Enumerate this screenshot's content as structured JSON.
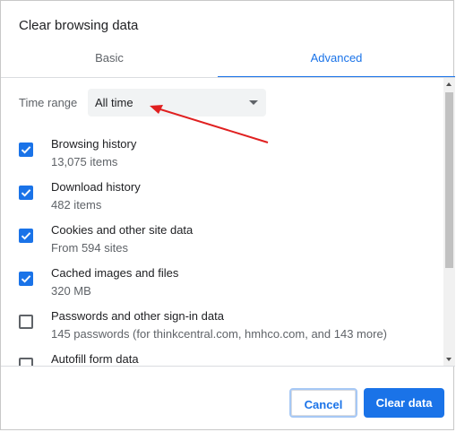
{
  "dialog": {
    "title": "Clear browsing data",
    "tabs": [
      {
        "label": "Basic",
        "active": false
      },
      {
        "label": "Advanced",
        "active": true
      }
    ],
    "time_range": {
      "label": "Time range",
      "value": "All time"
    },
    "items": [
      {
        "title": "Browsing history",
        "subtitle": "13,075 items",
        "checked": true
      },
      {
        "title": "Download history",
        "subtitle": "482 items",
        "checked": true
      },
      {
        "title": "Cookies and other site data",
        "subtitle": "From 594 sites",
        "checked": true
      },
      {
        "title": "Cached images and files",
        "subtitle": "320 MB",
        "checked": true
      },
      {
        "title": "Passwords and other sign-in data",
        "subtitle": "145 passwords (for thinkcentral.com, hmhco.com, and 143 more)",
        "checked": false
      },
      {
        "title": "Autofill form data",
        "subtitle": "",
        "checked": false
      }
    ],
    "buttons": {
      "cancel": "Cancel",
      "clear": "Clear data"
    }
  },
  "colors": {
    "accent": "#1a73e8",
    "annotation_arrow": "#e02020"
  }
}
